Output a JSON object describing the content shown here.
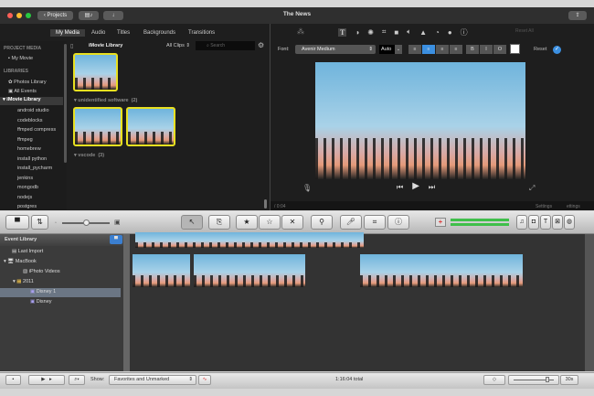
{
  "window": {
    "title": "The News",
    "projects_button": "Projects"
  },
  "tabs": [
    "My Media",
    "Audio",
    "Titles",
    "Backgrounds",
    "Transitions"
  ],
  "sidebar": {
    "project_media_header": "PROJECT MEDIA",
    "my_movie": "My Movie",
    "libraries_header": "LIBRARIES",
    "photos_library": "Photos Library",
    "all_events": "All Events",
    "imovie_library": "iMovie Library",
    "events": [
      "android studio",
      "codeblocks",
      "ffmped compress",
      "ffmpeg",
      "homebrew",
      "install python",
      "install_pycharm",
      "jenkins",
      "mongodb",
      "nodejs",
      "postgres"
    ]
  },
  "browser": {
    "library_label": "iMovie Library",
    "filter": "All Clips",
    "search_placeholder": "Search",
    "groups": [
      {
        "name": "unidentified software",
        "count": "(2)"
      },
      {
        "name": "vscode",
        "count": "(3)"
      }
    ]
  },
  "viewer": {
    "reset_all": "Reset All",
    "font_label": "Font:",
    "font_value": "Avenir Medium",
    "size_value": "Auto",
    "bold": "B",
    "italic": "I",
    "outline": "O",
    "reset": "Reset",
    "timecode": "0:04",
    "settings": "Settings",
    "settings2": "ettings"
  },
  "colors": {
    "accent": "#3b8fe0",
    "selection": "#e8e020"
  },
  "event_library": {
    "title": "Event Library",
    "items": [
      "Last Import",
      "MacBook",
      "iPhoto Videos",
      "2011",
      "Disney 1",
      "Disney"
    ]
  },
  "bottom": {
    "show_label": "Show:",
    "show_value": "Favorites and Unmarked",
    "total": "1:16:04 total",
    "zoom_value": "30s"
  }
}
